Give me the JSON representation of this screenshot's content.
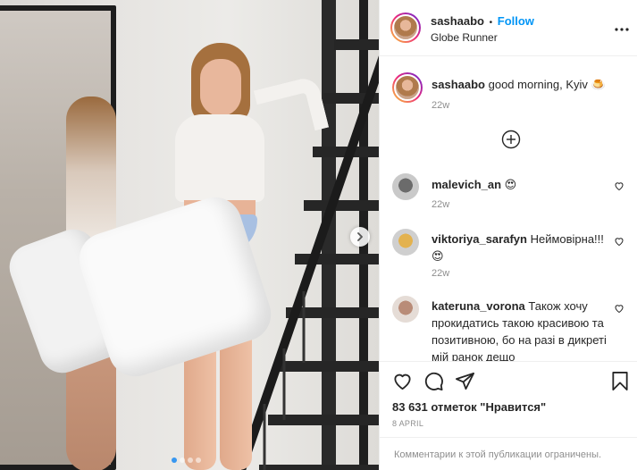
{
  "post": {
    "images_count": 4,
    "current_image": 1
  },
  "header": {
    "username": "sashaabo",
    "separator": "•",
    "follow_label": "Follow",
    "location": "Globe Runner",
    "more_label": "•••"
  },
  "caption": {
    "username": "sashaabo",
    "text": "good morning, Kyiv 🍮",
    "time": "22w"
  },
  "comments": [
    {
      "username": "malevich_an",
      "text": "😍",
      "time": "22w"
    },
    {
      "username": "viktoriya_sarafyn",
      "text": "Неймовірна!!! 😍",
      "time": "22w"
    },
    {
      "username": "kateruna_vorona",
      "text": "Також хочу прокидатись такою красивою та позитивною, бо на разі в дикреті мій ранок дещо",
      "time": ""
    }
  ],
  "stats": {
    "likes": "83 631 отметок \"Нравится\"",
    "date": "8 APRIL"
  },
  "footer": {
    "restricted": "Комментарии к этой публикации ограничены."
  },
  "colors": {
    "accent": "#0095f6",
    "text": "#262626",
    "muted": "#8e8e8e",
    "border": "#efefef"
  },
  "icons": [
    "chevron-right-icon",
    "more-icon",
    "plus-circle-icon",
    "heart-icon",
    "comment-icon",
    "share-icon",
    "bookmark-icon"
  ]
}
